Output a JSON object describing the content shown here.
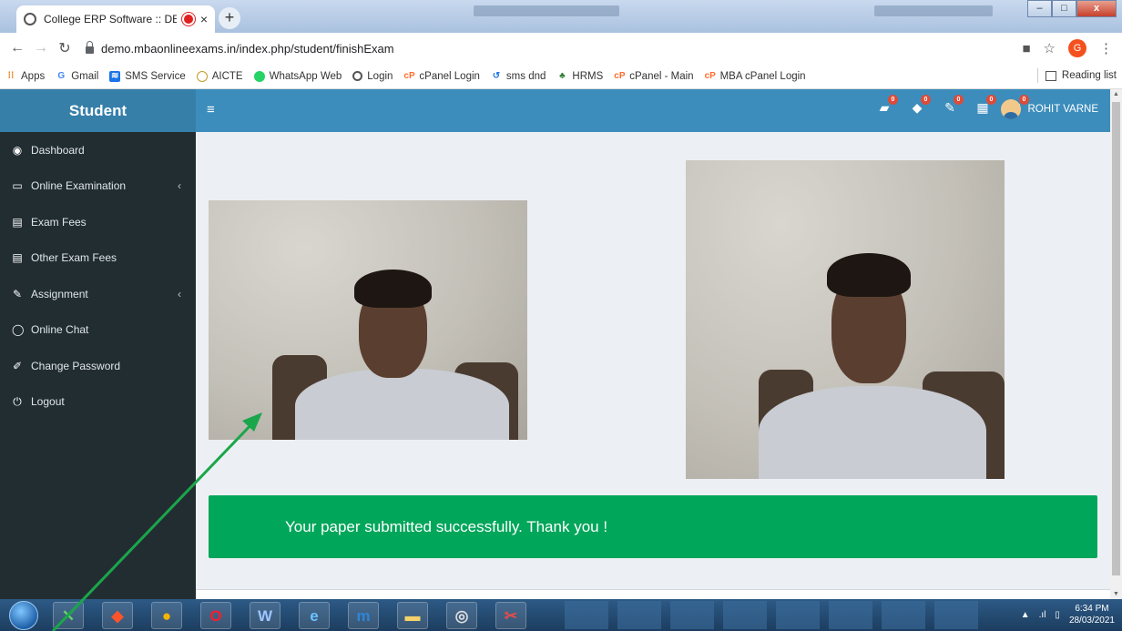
{
  "browser": {
    "tab_title": "College ERP Software :: DEM",
    "tab_close": "×",
    "new_tab": "+",
    "window_min": "–",
    "window_max": "□",
    "window_close": "x",
    "url": "demo.mbaonlineexams.in/index.php/student/finishExam",
    "profile_initial": "G",
    "bookmarks": [
      {
        "label": "Apps",
        "icon": "apps-grid-icon",
        "color": "#e37400"
      },
      {
        "label": "Gmail",
        "icon": "google-icon",
        "color": "#4285f4"
      },
      {
        "label": "SMS Service",
        "icon": "wifi-icon",
        "color": "#1a73e8"
      },
      {
        "label": "AICTE",
        "icon": "aicte-logo-icon",
        "color": "#c49a2a"
      },
      {
        "label": "WhatsApp Web",
        "icon": "whatsapp-icon",
        "color": "#25d366"
      },
      {
        "label": "Login",
        "icon": "globe-icon",
        "color": "#555555"
      },
      {
        "label": "cPanel Login",
        "icon": "cpanel-icon",
        "color": "#ff6c2c"
      },
      {
        "label": "sms dnd",
        "icon": "refresh-icon",
        "color": "#1a73e8"
      },
      {
        "label": "HRMS",
        "icon": "tree-icon",
        "color": "#2e7d32"
      },
      {
        "label": "cPanel - Main",
        "icon": "cpanel-icon",
        "color": "#ff6c2c"
      },
      {
        "label": "MBA cPanel Login",
        "icon": "cpanel-icon",
        "color": "#ff6c2c"
      }
    ],
    "reading_list": "Reading list"
  },
  "app": {
    "brand": "Student",
    "user_name": "ROHIT VARNE",
    "nav_badges": [
      "0",
      "0",
      "0",
      "0",
      "0"
    ],
    "menu": [
      {
        "label": "Dashboard",
        "icon": "dashboard-icon",
        "glyph": "◉",
        "chevron": ""
      },
      {
        "label": "Online Examination",
        "icon": "laptop-icon",
        "glyph": "▭",
        "chevron": "‹"
      },
      {
        "label": "Exam Fees",
        "icon": "file-icon",
        "glyph": "▤",
        "chevron": ""
      },
      {
        "label": "Other Exam Fees",
        "icon": "file-icon",
        "glyph": "▤",
        "chevron": ""
      },
      {
        "label": "Assignment",
        "icon": "pencil-icon",
        "glyph": "✎",
        "chevron": "‹"
      },
      {
        "label": "Online Chat",
        "icon": "chat-bubble-icon",
        "glyph": "◯",
        "chevron": ""
      },
      {
        "label": "Change Password",
        "icon": "edit-icon",
        "glyph": "✐",
        "chevron": ""
      },
      {
        "label": "Logout",
        "icon": "power-icon",
        "glyph": "⏻",
        "chevron": ""
      }
    ],
    "success_message": "Your paper submitted successfully. Thank you !",
    "colors": {
      "brand": "#367fa9",
      "navbar": "#3c8dbc",
      "sidebar": "#222d32",
      "success": "#00a65a",
      "badge": "#dd4b39",
      "arrow": "#1aa64a"
    }
  },
  "taskbar": {
    "time": "6:34 PM",
    "date": "28/03/2021"
  }
}
